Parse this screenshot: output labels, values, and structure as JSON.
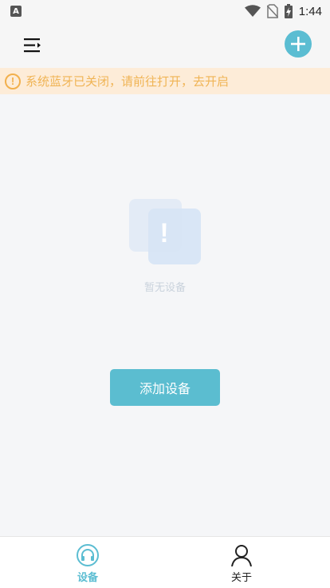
{
  "status_bar": {
    "left_icon": "A",
    "time": "1:44",
    "icons": [
      "wifi-icon",
      "no-sim-icon",
      "battery-charging-icon"
    ]
  },
  "header": {
    "menu_icon": "menu-expand-icon",
    "add_icon": "plus-circle-icon"
  },
  "banner": {
    "icon": "!",
    "text": "系统蓝牙已关闭，请前往打开，去开启"
  },
  "empty_state": {
    "illustration_glyph": "!",
    "text": "暂无设备"
  },
  "actions": {
    "add_device_label": "添加设备"
  },
  "tabs": [
    {
      "label": "设备",
      "icon": "headphones-icon",
      "active": true
    },
    {
      "label": "关于",
      "icon": "user-icon",
      "active": false
    }
  ],
  "colors": {
    "accent": "#5bbdd2",
    "banner_bg": "#fdecd8",
    "banner_text": "#f0b455",
    "background": "#f5f6f8"
  }
}
